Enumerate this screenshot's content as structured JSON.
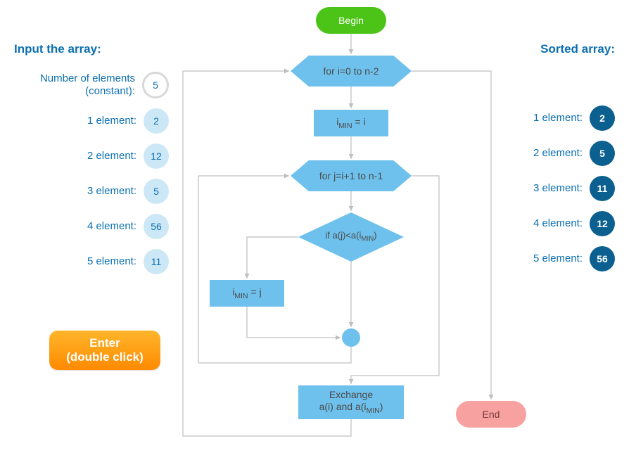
{
  "left": {
    "title": "Input the array:",
    "count_label": "Number of elements (constant):",
    "count_value": "5",
    "items": [
      {
        "label": "1 element:",
        "value": "2"
      },
      {
        "label": "2 element:",
        "value": "12"
      },
      {
        "label": "3 element:",
        "value": "5"
      },
      {
        "label": "4 element:",
        "value": "56"
      },
      {
        "label": "5 element:",
        "value": "11"
      }
    ]
  },
  "right": {
    "title": "Sorted array:",
    "items": [
      {
        "label": "1 element:",
        "value": "2"
      },
      {
        "label": "2 element:",
        "value": "5"
      },
      {
        "label": "3 element:",
        "value": "11"
      },
      {
        "label": "4 element:",
        "value": "12"
      },
      {
        "label": "5 element:",
        "value": "56"
      }
    ]
  },
  "button": {
    "line1": "Enter",
    "line2": "(double click)"
  },
  "flow": {
    "begin": "Begin",
    "loop_i": "for i=0 to n-2",
    "set_imin_i_pre": "i",
    "set_imin_i_sub": "MIN",
    "set_imin_i_post": " = i",
    "loop_j": "for j=i+1 to n-1",
    "cond_pre": "if a(j)<a(i",
    "cond_sub": "MIN",
    "cond_post": ")",
    "set_imin_j_pre": "i",
    "set_imin_j_sub": "MIN",
    "set_imin_j_post": " = j",
    "exchange_line1": "Exchange",
    "exchange_pre": "a(i) and a(i",
    "exchange_sub": "MIN",
    "exchange_post": ")",
    "end": "End"
  }
}
